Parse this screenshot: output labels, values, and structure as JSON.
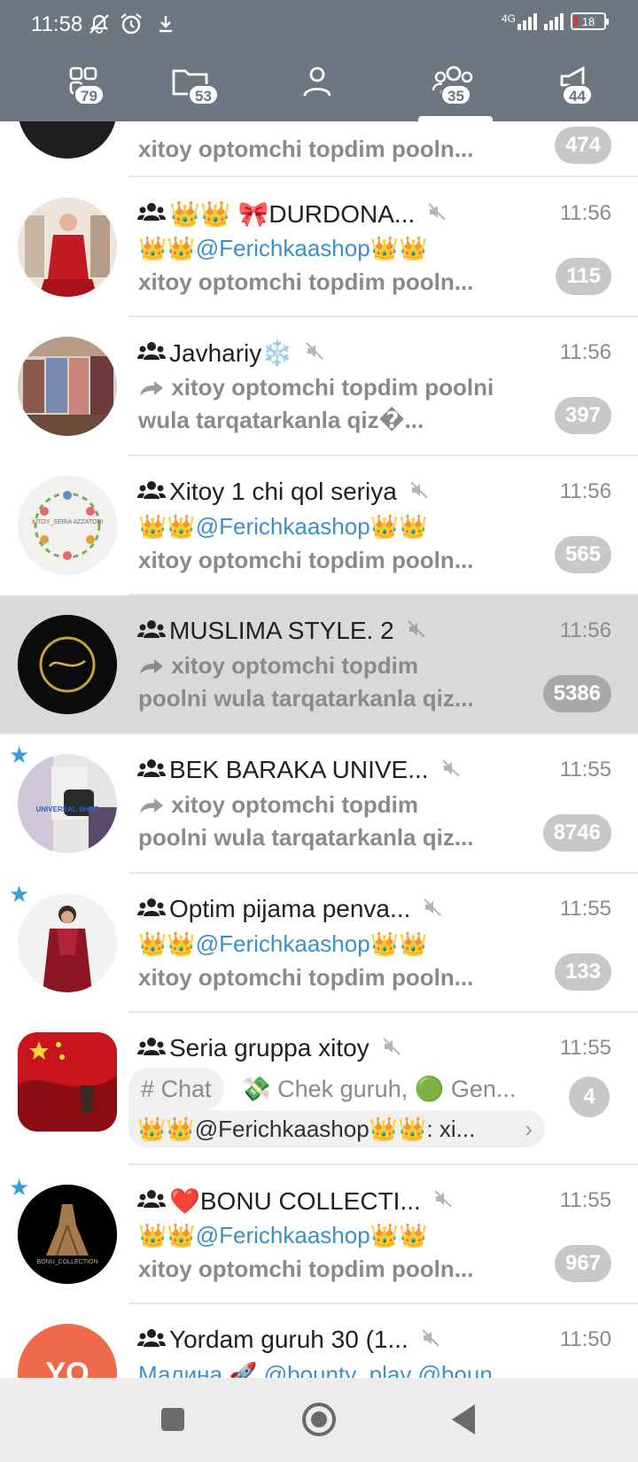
{
  "status": {
    "time": "11:58",
    "network": "4G",
    "battery": "18"
  },
  "tabs": [
    {
      "icon": "apps-icon",
      "count": "79"
    },
    {
      "icon": "folder-icon",
      "count": "53"
    },
    {
      "icon": "person-icon",
      "count": ""
    },
    {
      "icon": "groups-icon",
      "count": "35",
      "active": true
    },
    {
      "icon": "megaphone-icon",
      "count": "44"
    }
  ],
  "chats": [
    {
      "title": "",
      "line1": "xitoy optomchi topdim pooln...",
      "line2": "",
      "time": "",
      "badge": "474",
      "avatar": "dark"
    },
    {
      "title": "👑👑 🎀DURDONA...",
      "line1": "👑👑@Ferichkaashop👑👑",
      "line2": "xitoy optomchi topdim pooln...",
      "time": "11:56",
      "badge": "115",
      "avatar": "red-dress"
    },
    {
      "title": "Javhariy❄️",
      "line1": "xitoy optomchi topdim poolni",
      "line2": "wula tarqatarkanla qiz�...",
      "time": "11:56",
      "badge": "397",
      "avatar": "clothes",
      "forwarded": true
    },
    {
      "title": "Xitoy 1 chi qol seriya",
      "line1": "👑👑@Ferichkaashop👑👑",
      "line2": "xitoy optomchi topdim pooln...",
      "time": "11:56",
      "badge": "565",
      "avatar": "floral",
      "avatar_text": "XITOY_SERIA AZZATORI"
    },
    {
      "title": "MUSLIMA STYLE. 2",
      "line1": "xitoy optomchi topdim",
      "line2": "poolni wula tarqatarkanla qiz...",
      "time": "11:56",
      "badge": "5386",
      "avatar": "gold-logo",
      "forwarded": true,
      "selected": true
    },
    {
      "title": "BEK BARAKA UNIVE...",
      "line1": "xitoy optomchi topdim",
      "line2": "poolni wula tarqatarkanla qiz...",
      "time": "11:55",
      "badge": "8746",
      "avatar": "universal",
      "avatar_text": "UNIVERSAL SHOP",
      "forwarded": true,
      "starred": true
    },
    {
      "title": "Optim pijama penva...",
      "line1": "👑👑@Ferichkaashop👑👑",
      "line2": "xitoy optomchi topdim pooln...",
      "time": "11:55",
      "badge": "133",
      "avatar": "pajama",
      "starred": true
    },
    {
      "title": "Seria gruppa xitoy",
      "topic": "# Chat",
      "topic_rest": "💸 Chek guruh, 🟢 Gen...",
      "topic_line2": "👑👑@Ferichkaashop👑👑: xi...",
      "time": "11:55",
      "badge": "4",
      "avatar": "china-flag"
    },
    {
      "title": "❤️BONU COLLECTI...",
      "line1": "👑👑@Ferichkaashop👑👑",
      "line2": "xitoy optomchi topdim pooln...",
      "time": "11:55",
      "badge": "967",
      "avatar": "bonu",
      "avatar_text": "BONU_COLLECTION",
      "starred": true
    },
    {
      "title": "Yordam guruh 30 (1...",
      "line1": "Малина 🚀 @bounty_play @boun...",
      "line2": "",
      "time": "11:50",
      "badge": "",
      "avatar": "initials",
      "avatar_text": "YO"
    }
  ],
  "colors": {
    "header": "#6c7782",
    "accent_blue": "#3e8fc6",
    "star": "#3a9edb",
    "badge": "#c8c8c8"
  },
  "nav": [
    {
      "icon": "square-icon"
    },
    {
      "icon": "home-circle-icon"
    },
    {
      "icon": "back-triangle-icon"
    }
  ]
}
